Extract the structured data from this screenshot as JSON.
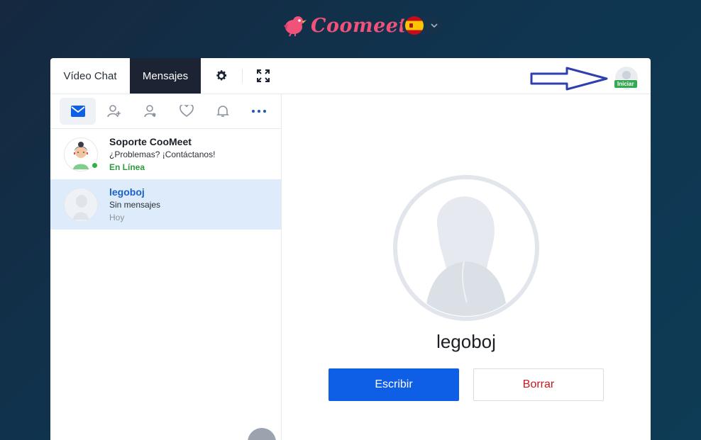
{
  "brand": {
    "name": "Coomeet"
  },
  "language": {
    "selected": "es",
    "icon": "spain-flag-icon"
  },
  "colors": {
    "brand_pink": "#f0527a",
    "primary_blue": "#0f5ee6",
    "online_green": "#34b04a",
    "delete_red": "#c8181e",
    "dark_tab": "#1c2433"
  },
  "topbar": {
    "tabs": [
      {
        "label": "Vídeo Chat"
      },
      {
        "label": "Mensajes"
      }
    ],
    "icons": [
      "gear-icon",
      "fullscreen-icon"
    ],
    "badge": "Iniciar"
  },
  "subtabs": [
    "mail-icon",
    "add-user-icon",
    "user-icon",
    "heart-icon",
    "bell-icon",
    "more-icon"
  ],
  "contacts": [
    {
      "name": "Soporte CooMeet",
      "message": "¿Problemas? ¡Contáctanos!",
      "status": "En Línea"
    },
    {
      "name": "legoboj",
      "message": "Sin mensajes",
      "status": "Hoy"
    }
  ],
  "profile": {
    "name": "legoboj",
    "write_label": "Escribir",
    "delete_label": "Borrar"
  }
}
